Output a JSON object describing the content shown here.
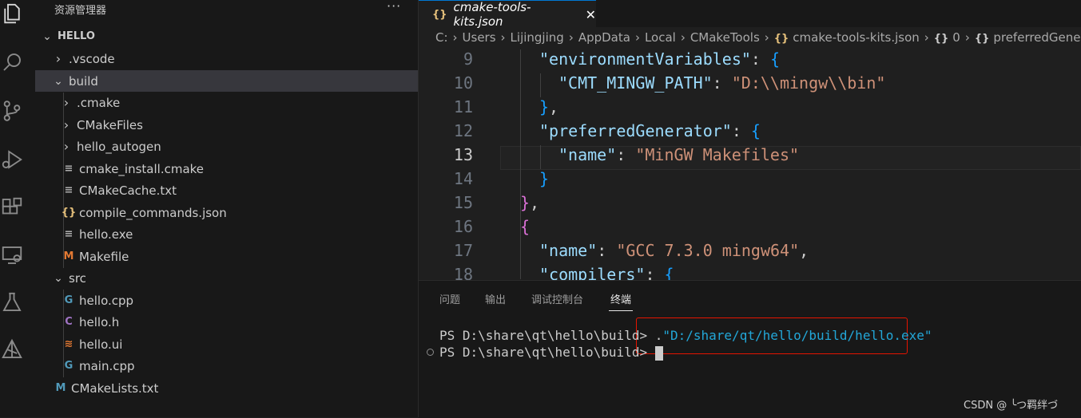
{
  "activity_bar": {
    "icons": [
      "explorer-icon",
      "search-icon",
      "source-control-icon",
      "run-debug-icon",
      "extensions-icon",
      "remote-explorer-icon",
      "testing-icon",
      "cmake-icon"
    ]
  },
  "sidebar": {
    "title": "资源管理器",
    "more": "···",
    "tree": [
      {
        "label": "HELLO",
        "chev": "⌄",
        "icon": "",
        "bold": true
      },
      {
        "label": ".vscode",
        "chev": "›",
        "icon": ""
      },
      {
        "label": "build",
        "chev": "⌄",
        "icon": ""
      },
      {
        "label": ".cmake",
        "chev": "›",
        "icon": ""
      },
      {
        "label": "CMakeFiles",
        "chev": "›",
        "icon": ""
      },
      {
        "label": "hello_autogen",
        "chev": "›",
        "icon": ""
      },
      {
        "label": "cmake_install.cmake",
        "chev": "",
        "icon": "≡",
        "color": "#b0b0b0"
      },
      {
        "label": "CMakeCache.txt",
        "chev": "",
        "icon": "≡",
        "color": "#b0b0b0"
      },
      {
        "label": "compile_commands.json",
        "chev": "",
        "icon": "{}",
        "color": "#e5c07b"
      },
      {
        "label": "hello.exe",
        "chev": "",
        "icon": "≡",
        "color": "#b0b0b0"
      },
      {
        "label": "Makefile",
        "chev": "",
        "icon": "M",
        "color": "#e37933"
      },
      {
        "label": "src",
        "chev": "⌄",
        "icon": ""
      },
      {
        "label": "hello.cpp",
        "chev": "",
        "icon": "G",
        "color": "#519aba"
      },
      {
        "label": "hello.h",
        "chev": "",
        "icon": "C",
        "color": "#a074c4"
      },
      {
        "label": "hello.ui",
        "chev": "",
        "icon": "≋",
        "color": "#e37933"
      },
      {
        "label": "main.cpp",
        "chev": "",
        "icon": "G",
        "color": "#519aba"
      },
      {
        "label": "CMakeLists.txt",
        "chev": "",
        "icon": "M",
        "color": "#519aba"
      }
    ]
  },
  "editor": {
    "tab": {
      "icon": "{}",
      "label": "cmake-tools-kits.json",
      "close": "✕"
    },
    "breadcrumb": [
      "C:",
      "Users",
      "Lijingjing",
      "AppData",
      "Local",
      "CMakeTools",
      "{} cmake-tools-kits.json",
      "{} 0",
      "{} preferredGener"
    ],
    "lines": [
      {
        "n": "9",
        "parts": [
          [
            "k",
            "\"environmentVariables\""
          ],
          [
            "p",
            ": "
          ],
          [
            "b2",
            "{"
          ]
        ]
      },
      {
        "n": "10",
        "parts": [
          [
            "k",
            "\"CMT_MINGW_PATH\""
          ],
          [
            "p",
            ": "
          ],
          [
            "s",
            "\"D:\\\\mingw\\\\bin\""
          ]
        ]
      },
      {
        "n": "11",
        "parts": [
          [
            "b2",
            "}"
          ],
          [
            "p",
            ","
          ]
        ]
      },
      {
        "n": "12",
        "parts": [
          [
            "k",
            "\"preferredGenerator\""
          ],
          [
            "p",
            ": "
          ],
          [
            "b2",
            "{"
          ]
        ]
      },
      {
        "n": "13",
        "parts": [
          [
            "k",
            "\"name\""
          ],
          [
            "p",
            ": "
          ],
          [
            "s",
            "\"MinGW Makefiles\""
          ]
        ]
      },
      {
        "n": "14",
        "parts": [
          [
            "b2",
            "}"
          ]
        ]
      },
      {
        "n": "15",
        "parts": [
          [
            "b1",
            "}"
          ],
          [
            "p",
            ","
          ]
        ]
      },
      {
        "n": "16",
        "parts": [
          [
            "b1",
            "{"
          ]
        ]
      },
      {
        "n": "17",
        "parts": [
          [
            "k",
            "\"name\""
          ],
          [
            "p",
            ": "
          ],
          [
            "s",
            "\"GCC 7.3.0 mingw64\""
          ],
          [
            "p",
            ","
          ]
        ]
      },
      {
        "n": "18",
        "parts": [
          [
            "k",
            "\"compilers\""
          ],
          [
            "p",
            ": "
          ],
          [
            "b2",
            "{"
          ]
        ]
      }
    ]
  },
  "panel": {
    "tabs": [
      "问题",
      "输出",
      "调试控制台",
      "终端"
    ],
    "active_tab": "终端",
    "terminal": {
      "line1_prompt": "PS D:\\share\\qt\\hello\\build> ",
      "line1_cmd": ".",
      "line1_str": "\"D:/share/qt/hello/build/hello.exe\"",
      "line2_prompt": "PS D:\\share\\qt\\hello\\build> "
    }
  },
  "watermark": "CSDN @ ╰つ羁绊づ"
}
